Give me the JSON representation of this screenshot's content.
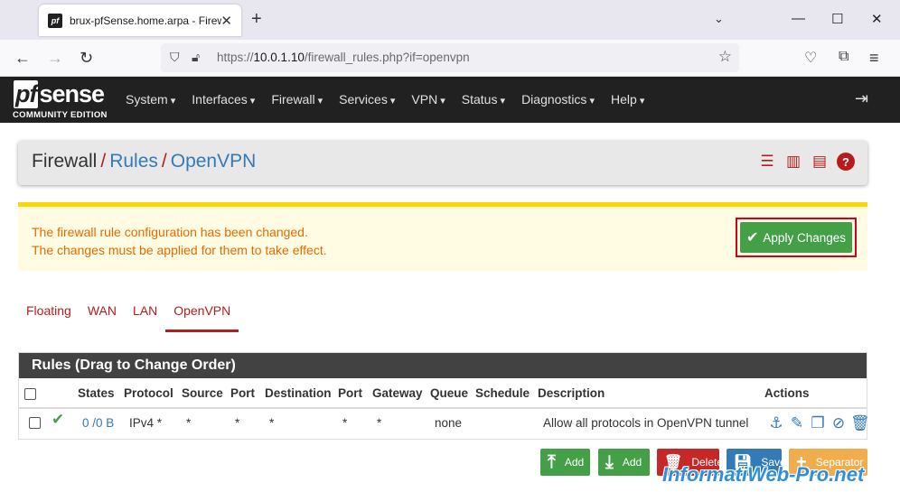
{
  "browser": {
    "tab_title": "brux-pfSense.home.arpa - Firewall: Rules: OpenVPN",
    "favicon_text": "pf",
    "url_prefix": "https://",
    "url_host": "10.0.1.10",
    "url_path": "/firewall_rules.php?if=openvpn"
  },
  "pf_nav": {
    "logo_pf": "pf",
    "logo_sense": "sense",
    "logo_sub": "COMMUNITY EDITION",
    "menu": [
      "System",
      "Interfaces",
      "Firewall",
      "Services",
      "VPN",
      "Status",
      "Diagnostics",
      "Help"
    ]
  },
  "breadcrumb": {
    "part1": "Firewall",
    "sep": "/",
    "part2": "Rules",
    "part3": "OpenVPN"
  },
  "alert": {
    "line1": "The firewall rule configuration has been changed.",
    "line2": "The changes must be applied for them to take effect.",
    "apply_label": "Apply Changes"
  },
  "tabs": [
    "Floating",
    "WAN",
    "LAN",
    "OpenVPN"
  ],
  "rules": {
    "title": "Rules (Drag to Change Order)",
    "columns": [
      "States",
      "Protocol",
      "Source",
      "Port",
      "Destination",
      "Port",
      "Gateway",
      "Queue",
      "Schedule",
      "Description",
      "Actions"
    ],
    "rows": [
      {
        "states": "0 /0 B",
        "protocol": "IPv4 *",
        "source": "*",
        "source_port": "*",
        "destination": "*",
        "dest_port": "*",
        "gateway": "*",
        "queue": "none",
        "schedule": "",
        "description": "Allow all protocols in OpenVPN tunnel"
      }
    ]
  },
  "buttons": {
    "add_top": "Add",
    "add_bottom": "Add",
    "delete": "Delete",
    "save": "Save",
    "separator": "Separator"
  },
  "watermark": "InformatiWeb-Pro.net",
  "colors": {
    "pf_dark": "#212121",
    "pf_red": "#b71c1c",
    "link_blue": "#337ab7",
    "success_green": "#43a047",
    "alert_bg": "#fffce3",
    "alert_border": "#ffd600",
    "alert_text": "#e66a00"
  }
}
